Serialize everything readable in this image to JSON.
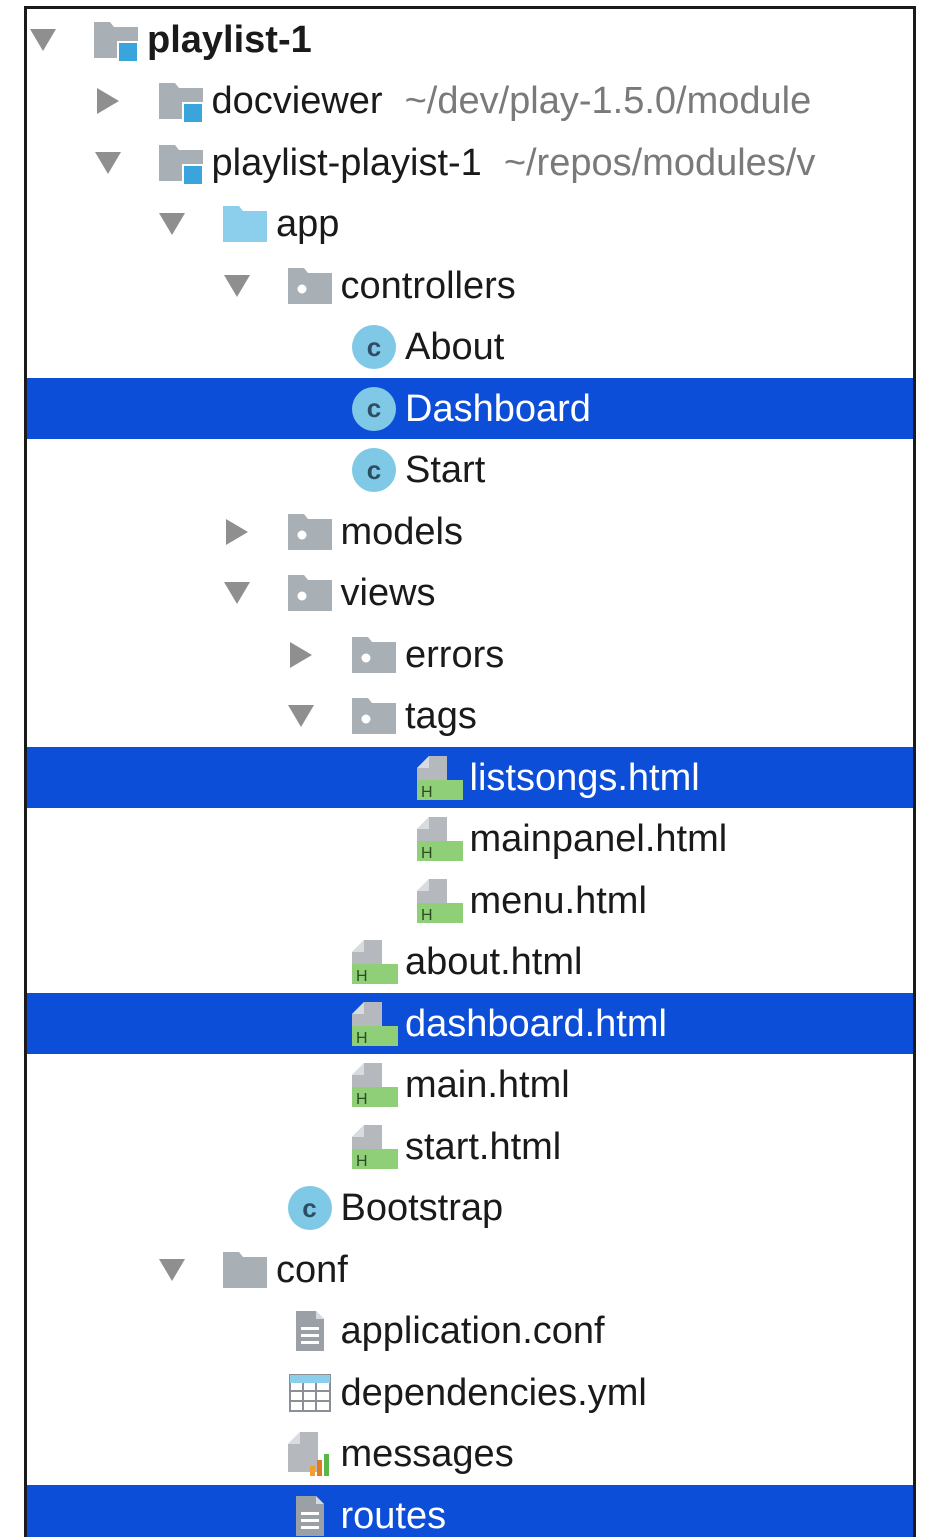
{
  "tree": {
    "rows": [
      {
        "id": "playlist-1",
        "label": "playlist-1",
        "path": "",
        "level": 0,
        "arrow": "down",
        "icon": "module-folder-icon",
        "bold": true,
        "selected": false
      },
      {
        "id": "docviewer",
        "label": "docviewer",
        "path": "~/dev/play-1.5.0/module",
        "level": 1,
        "arrow": "right",
        "icon": "module-folder-icon",
        "bold": false,
        "selected": false
      },
      {
        "id": "playlist-playist-1",
        "label": "playlist-playist-1",
        "path": "~/repos/modules/v",
        "level": 1,
        "arrow": "down",
        "icon": "module-folder-icon",
        "bold": false,
        "selected": false
      },
      {
        "id": "app",
        "label": "app",
        "path": "",
        "level": 2,
        "arrow": "down",
        "icon": "source-folder-icon",
        "bold": false,
        "selected": false
      },
      {
        "id": "controllers",
        "label": "controllers",
        "path": "",
        "level": 3,
        "arrow": "down",
        "icon": "package-folder-icon",
        "bold": false,
        "selected": false
      },
      {
        "id": "about-class",
        "label": "About",
        "path": "",
        "level": 4,
        "arrow": "none",
        "icon": "class-icon",
        "bold": false,
        "selected": false
      },
      {
        "id": "dashboard-class",
        "label": "Dashboard",
        "path": "",
        "level": 4,
        "arrow": "none",
        "icon": "class-icon",
        "bold": false,
        "selected": true
      },
      {
        "id": "start-class",
        "label": "Start",
        "path": "",
        "level": 4,
        "arrow": "none",
        "icon": "class-icon",
        "bold": false,
        "selected": false
      },
      {
        "id": "models",
        "label": "models",
        "path": "",
        "level": 3,
        "arrow": "right",
        "icon": "package-folder-icon",
        "bold": false,
        "selected": false
      },
      {
        "id": "views",
        "label": "views",
        "path": "",
        "level": 3,
        "arrow": "down",
        "icon": "package-folder-icon",
        "bold": false,
        "selected": false
      },
      {
        "id": "errors",
        "label": "errors",
        "path": "",
        "level": 4,
        "arrow": "right",
        "icon": "package-folder-icon",
        "bold": false,
        "selected": false
      },
      {
        "id": "tags",
        "label": "tags",
        "path": "",
        "level": 4,
        "arrow": "down",
        "icon": "package-folder-icon",
        "bold": false,
        "selected": false
      },
      {
        "id": "listsongs",
        "label": "listsongs.html",
        "path": "",
        "level": 5,
        "arrow": "none",
        "icon": "html-file-icon",
        "bold": false,
        "selected": true
      },
      {
        "id": "mainpanel",
        "label": "mainpanel.html",
        "path": "",
        "level": 5,
        "arrow": "none",
        "icon": "html-file-icon",
        "bold": false,
        "selected": false
      },
      {
        "id": "menu",
        "label": "menu.html",
        "path": "",
        "level": 5,
        "arrow": "none",
        "icon": "html-file-icon",
        "bold": false,
        "selected": false
      },
      {
        "id": "about-html",
        "label": "about.html",
        "path": "",
        "level": 4,
        "arrow": "none",
        "icon": "html-file-icon",
        "bold": false,
        "selected": false
      },
      {
        "id": "dashboard-html",
        "label": "dashboard.html",
        "path": "",
        "level": 4,
        "arrow": "none",
        "icon": "html-file-icon",
        "bold": false,
        "selected": true
      },
      {
        "id": "main-html",
        "label": "main.html",
        "path": "",
        "level": 4,
        "arrow": "none",
        "icon": "html-file-icon",
        "bold": false,
        "selected": false
      },
      {
        "id": "start-html",
        "label": "start.html",
        "path": "",
        "level": 4,
        "arrow": "none",
        "icon": "html-file-icon",
        "bold": false,
        "selected": false
      },
      {
        "id": "bootstrap",
        "label": "Bootstrap",
        "path": "",
        "level": 3,
        "arrow": "none",
        "icon": "class-icon",
        "bold": false,
        "selected": false
      },
      {
        "id": "conf",
        "label": "conf",
        "path": "",
        "level": 2,
        "arrow": "down",
        "icon": "folder-icon",
        "bold": false,
        "selected": false
      },
      {
        "id": "application-conf",
        "label": "application.conf",
        "path": "",
        "level": 3,
        "arrow": "none",
        "icon": "text-file-icon",
        "bold": false,
        "selected": false
      },
      {
        "id": "dependencies",
        "label": "dependencies.yml",
        "path": "",
        "level": 3,
        "arrow": "none",
        "icon": "yml-file-icon",
        "bold": false,
        "selected": false
      },
      {
        "id": "messages",
        "label": "messages",
        "path": "",
        "level": 3,
        "arrow": "none",
        "icon": "properties-file-icon",
        "bold": false,
        "selected": false
      },
      {
        "id": "routes",
        "label": "routes",
        "path": "",
        "level": 3,
        "arrow": "none",
        "icon": "text-file-icon",
        "bold": false,
        "selected": true
      }
    ]
  },
  "icons": {
    "class_letter": "c",
    "html_letter": "H"
  },
  "colors": {
    "selection": "#0d4ed8",
    "class_icon": "#7fc8e6",
    "html_badge": "#8fcf78",
    "folder": "#a8b0b6",
    "source_folder": "#8ccfec",
    "module_badge": "#3aa4dc"
  }
}
